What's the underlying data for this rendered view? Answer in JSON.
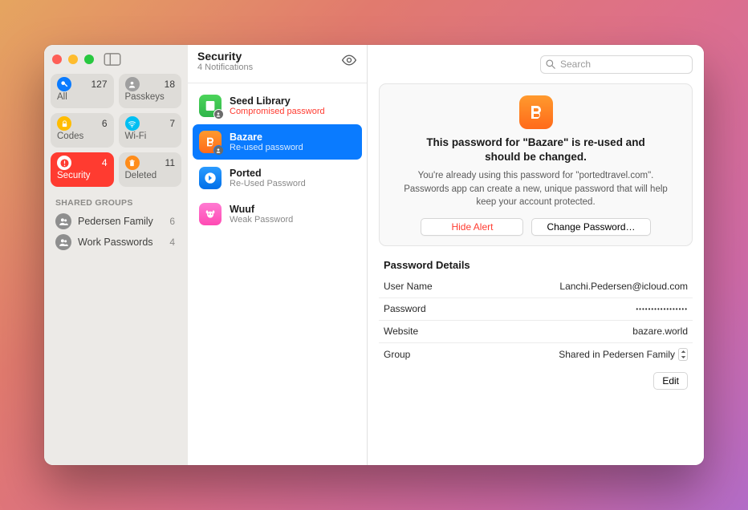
{
  "sidebar": {
    "categories": [
      {
        "label": "All",
        "count": "127"
      },
      {
        "label": "Passkeys",
        "count": "18"
      },
      {
        "label": "Codes",
        "count": "6"
      },
      {
        "label": "Wi-Fi",
        "count": "7"
      },
      {
        "label": "Security",
        "count": "4"
      },
      {
        "label": "Deleted",
        "count": "11"
      }
    ],
    "shared_header": "SHARED GROUPS",
    "groups": [
      {
        "label": "Pedersen Family",
        "count": "6"
      },
      {
        "label": "Work Passwords",
        "count": "4"
      }
    ]
  },
  "mid": {
    "title": "Security",
    "subtitle": "4 Notifications",
    "items": [
      {
        "title": "Seed Library",
        "sub": "Compromised password"
      },
      {
        "title": "Bazare",
        "sub": "Re-used password"
      },
      {
        "title": "Ported",
        "sub": "Re-Used Password"
      },
      {
        "title": "Wuuf",
        "sub": "Weak Password"
      }
    ]
  },
  "search": {
    "placeholder": "Search"
  },
  "alert": {
    "title": "This password for \"Bazare\" is re-used and should be changed.",
    "body": "You're already using this password for \"portedtravel.com\". Passwords app can create a new, unique password that will help keep your account protected.",
    "hide": "Hide Alert",
    "change": "Change Password…"
  },
  "details": {
    "header": "Password Details",
    "username_k": "User Name",
    "username_v": "Lanchi.Pedersen@icloud.com",
    "password_k": "Password",
    "password_v": "•••••••••••••••••",
    "website_k": "Website",
    "website_v": "bazare.world",
    "group_k": "Group",
    "group_v": "Shared in Pedersen Family",
    "edit": "Edit"
  }
}
